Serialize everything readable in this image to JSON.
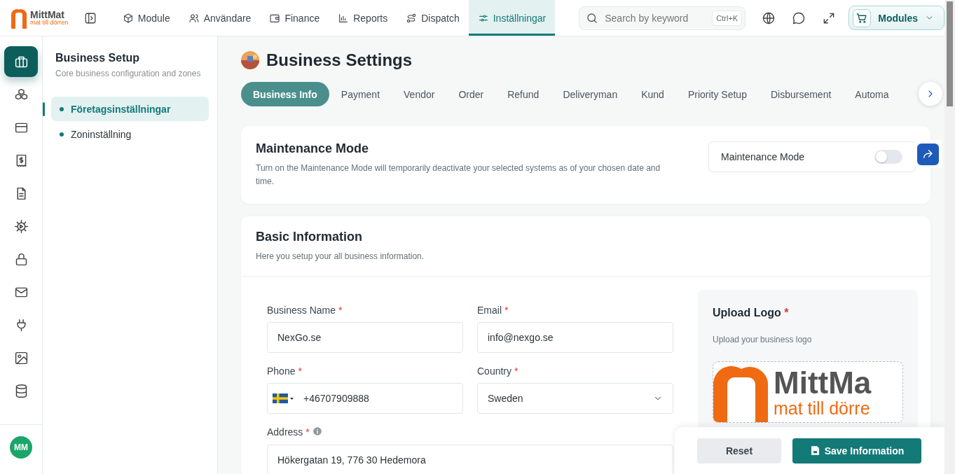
{
  "brand": {
    "name": "MittMat",
    "tagline": "mat till dörren"
  },
  "top_nav": [
    {
      "label": "Module",
      "selected": false
    },
    {
      "label": "Användare",
      "selected": false
    },
    {
      "label": "Finance",
      "selected": false
    },
    {
      "label": "Reports",
      "selected": false
    },
    {
      "label": "Dispatch",
      "selected": false
    },
    {
      "label": "Inställningar",
      "selected": true
    }
  ],
  "search": {
    "placeholder": "Search by keyword",
    "shortcut": "Ctrl+K"
  },
  "modules_button": "Modules",
  "rail": [
    {
      "selected": true
    },
    {
      "selected": false
    },
    {
      "selected": false
    },
    {
      "selected": false
    },
    {
      "selected": false
    },
    {
      "selected": false
    },
    {
      "selected": false
    },
    {
      "selected": false
    },
    {
      "selected": false
    },
    {
      "selected": false
    },
    {
      "selected": false
    }
  ],
  "avatar": "MM",
  "sidebar": {
    "title": "Business Setup",
    "subtitle": "Core business configuration and zones",
    "items": [
      {
        "label": "Företagsinställningar",
        "selected": true
      },
      {
        "label": "Zoninställning",
        "selected": false
      }
    ]
  },
  "page_title": "Business Settings",
  "tabs": [
    {
      "label": "Business Info",
      "selected": true
    },
    {
      "label": "Payment",
      "selected": false
    },
    {
      "label": "Vendor",
      "selected": false
    },
    {
      "label": "Order",
      "selected": false
    },
    {
      "label": "Refund",
      "selected": false
    },
    {
      "label": "Deliveryman",
      "selected": false
    },
    {
      "label": "Kund",
      "selected": false
    },
    {
      "label": "Priority Setup",
      "selected": false
    },
    {
      "label": "Disbursement",
      "selected": false
    },
    {
      "label": "Automa",
      "selected": false
    }
  ],
  "maintenance": {
    "title": "Maintenance Mode",
    "description": "Turn on the Maintenance Mode will temporarily deactivate your selected systems as of your chosen date and time.",
    "toggle_label": "Maintenance Mode",
    "on": false
  },
  "basic_info": {
    "title": "Basic Information",
    "subtitle": "Here you setup your all business information.",
    "fields": [
      {
        "kind": "text",
        "label": "Business Name",
        "mark": "*",
        "value": "NexGo.se"
      },
      {
        "kind": "text",
        "label": "Email",
        "mark": "*",
        "value": "info@nexgo.se"
      },
      {
        "kind": "phone",
        "label": "Phone",
        "mark": "*",
        "value": "+46707909888"
      },
      {
        "kind": "select",
        "label": "Country",
        "mark": "*",
        "value": "Sweden"
      },
      {
        "kind": "info",
        "label": "Address",
        "mark": "*",
        "value": "Hökergatan 19, 776 30 Hedemora"
      }
    ]
  },
  "upload": {
    "title": "Upload Logo",
    "mark": "*",
    "hint": "Upload your business logo",
    "preview": {
      "name": "MittMa",
      "tagline": "mat till dörre"
    }
  },
  "actions": {
    "reset": "Reset",
    "save": "Save Information"
  }
}
